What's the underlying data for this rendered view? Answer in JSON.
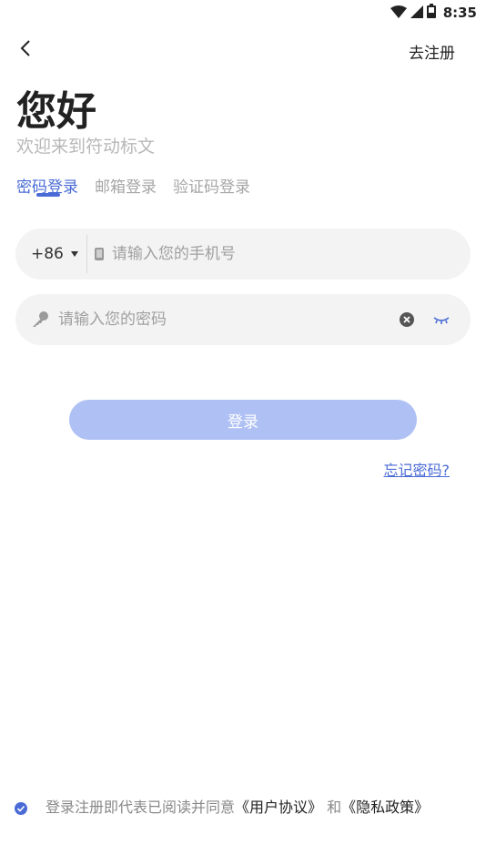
{
  "status_bar": {
    "time": "8:35"
  },
  "nav": {
    "register_label": "去注册"
  },
  "header": {
    "greeting": "您好",
    "welcome": "欢迎来到符动标文"
  },
  "tabs": [
    {
      "label": "密码登录",
      "active": true
    },
    {
      "label": "邮箱登录",
      "active": false
    },
    {
      "label": "验证码登录",
      "active": false
    }
  ],
  "phone": {
    "country_code": "+86",
    "placeholder": "请输入您的手机号"
  },
  "password": {
    "placeholder": "请输入您的密码"
  },
  "login_button": "登录",
  "forgot_password": "忘记密码?",
  "agreement": {
    "prefix": "登录注册即代表已阅读并同意",
    "user_agreement": "《用户协议》",
    "and": " 和",
    "privacy_policy": "《隐私政策》"
  },
  "colors": {
    "accent": "#4a6bd6",
    "button_disabled": "#afc0f4",
    "field_bg": "#f3f3f3"
  },
  "icons": [
    "wifi-icon",
    "signal-icon",
    "battery-icon",
    "back-arrow-icon",
    "phone-icon",
    "key-icon",
    "clear-icon",
    "eye-closed-icon",
    "check-circle-icon"
  ]
}
